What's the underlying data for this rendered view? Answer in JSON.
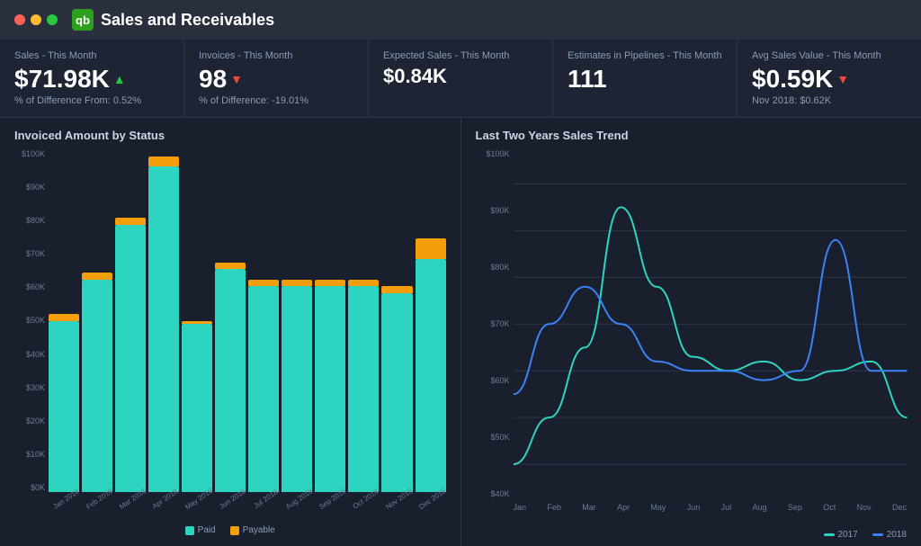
{
  "titleBar": {
    "title": "Sales and Receivables",
    "icon": "qb"
  },
  "kpis": [
    {
      "label": "Sales - This Month",
      "value": "$71.98K",
      "trend": "up",
      "sub": "% of Difference From: 0.52%"
    },
    {
      "label": "Invoices - This Month",
      "value": "98",
      "trend": "down",
      "sub": "% of Difference: -19.01%"
    },
    {
      "label": "Expected Sales - This Month",
      "value": "$0.84K",
      "trend": "none",
      "sub": ""
    },
    {
      "label": "Estimates in Pipelines - This Month",
      "value": "111",
      "trend": "none",
      "sub": ""
    },
    {
      "label": "Avg Sales Value - This Month",
      "value": "$0.59K",
      "trend": "down",
      "sub": "Nov 2018: $0.62K"
    }
  ],
  "barChart": {
    "title": "Invoiced Amount by Status",
    "yLabels": [
      "$0K",
      "$10K",
      "$20K",
      "$30K",
      "$40K",
      "$50K",
      "$60K",
      "$70K",
      "$80K",
      "$90K",
      "$100K"
    ],
    "xLabels": [
      "Jan 2018",
      "Feb 2018",
      "Mar 2018",
      "Apr 2018",
      "May 2018",
      "Jun 2018",
      "Jul 2018",
      "Aug 2018",
      "Sep 2018",
      "Oct 2018",
      "Nov 2018",
      "Dec 2018"
    ],
    "paidValues": [
      50,
      62,
      78,
      95,
      49,
      65,
      60,
      60,
      60,
      60,
      58,
      68
    ],
    "payableValues": [
      2,
      2,
      2,
      3,
      1,
      2,
      2,
      2,
      2,
      2,
      2,
      6
    ],
    "maxValue": 100,
    "legend": {
      "paid": "Paid",
      "payable": "Payable"
    }
  },
  "lineChart": {
    "title": "Last Two Years Sales Trend",
    "yLabels": [
      "$40K",
      "$50K",
      "$60K",
      "$70K",
      "$80K",
      "$90K",
      "$100K"
    ],
    "xLabels": [
      "Jan",
      "Feb",
      "Mar",
      "Apr",
      "May",
      "Jun",
      "Jul",
      "Aug",
      "Sep",
      "Oct",
      "Nov",
      "Dec"
    ],
    "series2017": [
      40,
      50,
      65,
      95,
      78,
      63,
      60,
      62,
      58,
      60,
      62,
      50
    ],
    "series2018": [
      55,
      70,
      78,
      70,
      62,
      60,
      60,
      58,
      60,
      88,
      60,
      60
    ],
    "legend": {
      "y2017": "2017",
      "y2018": "2018"
    }
  },
  "colors": {
    "paid": "#2dd4bf",
    "payable": "#f59e0b",
    "line2017": "#2dd4bf",
    "line2018": "#3b82f6",
    "background": "#1a1f2e",
    "cardBg": "#1e2433",
    "accent": "#2ca01c"
  }
}
